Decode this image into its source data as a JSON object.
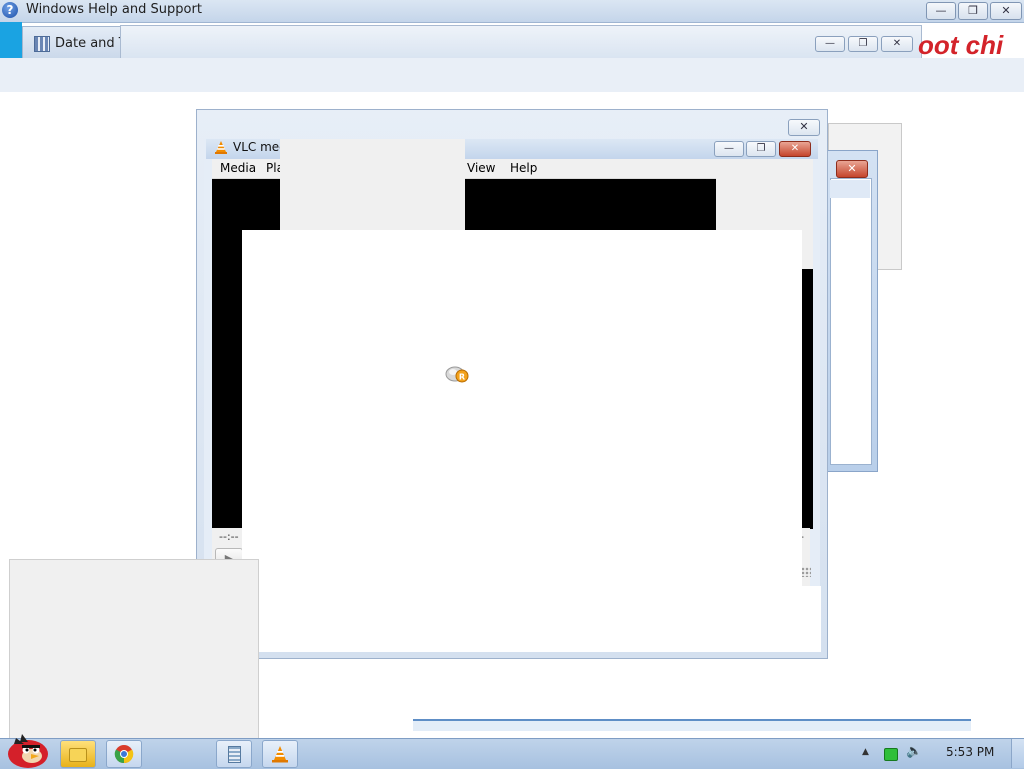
{
  "help_window": {
    "title": "Windows Help and Support",
    "minimize_glyph": "—",
    "restore_glyph": "❐",
    "close_glyph": "✕"
  },
  "date_time_window": {
    "title": "Date and Ti"
  },
  "back_window": {
    "minimize_glyph": "—",
    "restore_glyph": "❐",
    "close_glyph": "✕"
  },
  "background_red_text": "oot chi",
  "frame_window": {
    "close_glyph": "✕"
  },
  "vlc": {
    "title": "VLC med",
    "menu": [
      "Media",
      "Pla",
      "View",
      "Help"
    ],
    "minimize_glyph": "—",
    "restore_glyph": "❐",
    "close_glyph": "✕",
    "time_left": "--:--",
    "time_right": "-",
    "play_glyph": "▶"
  },
  "right_dialog": {
    "close_glyph": "✕"
  },
  "taskbar": {
    "clock": "5:53 PM",
    "tray_up_glyph": "▲",
    "volume_glyph": "🔈"
  },
  "colors": {
    "accent_blue": "#1aa3e2",
    "red_text": "#d3232a",
    "vlc_video_bg": "#000000"
  }
}
